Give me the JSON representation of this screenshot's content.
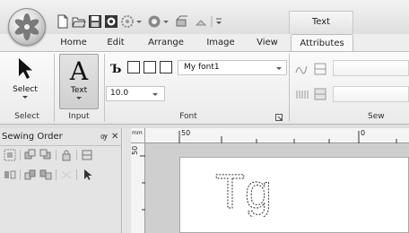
{
  "quick_access": {
    "icons": [
      "new-file-icon",
      "open-file-icon",
      "save-icon",
      "thread-color-icon",
      "sewing-icon",
      "color-wheel-icon",
      "undo-icon",
      "redo-icon",
      "customize-dropdown-icon"
    ]
  },
  "context_tab_header": "Text",
  "tabs": [
    "Home",
    "Edit",
    "Arrange",
    "Image",
    "View",
    "Attributes"
  ],
  "ribbon": {
    "select": {
      "button_label": "Select",
      "group_label": "Select"
    },
    "input": {
      "button_label": "Text",
      "group_label": "Input"
    },
    "font": {
      "font_name": "My font1",
      "font_size": "10.0",
      "group_label": "Font"
    },
    "sew": {
      "group_label": "Sew"
    }
  },
  "sewing_order": {
    "title": "Sewing Order",
    "pin_glyph": "ѹ",
    "close_glyph": "✕"
  },
  "ruler": {
    "unit": "mm",
    "h_labels": [
      "50",
      "0"
    ],
    "v_label": "50"
  },
  "canvas": {
    "text": "Tg"
  }
}
